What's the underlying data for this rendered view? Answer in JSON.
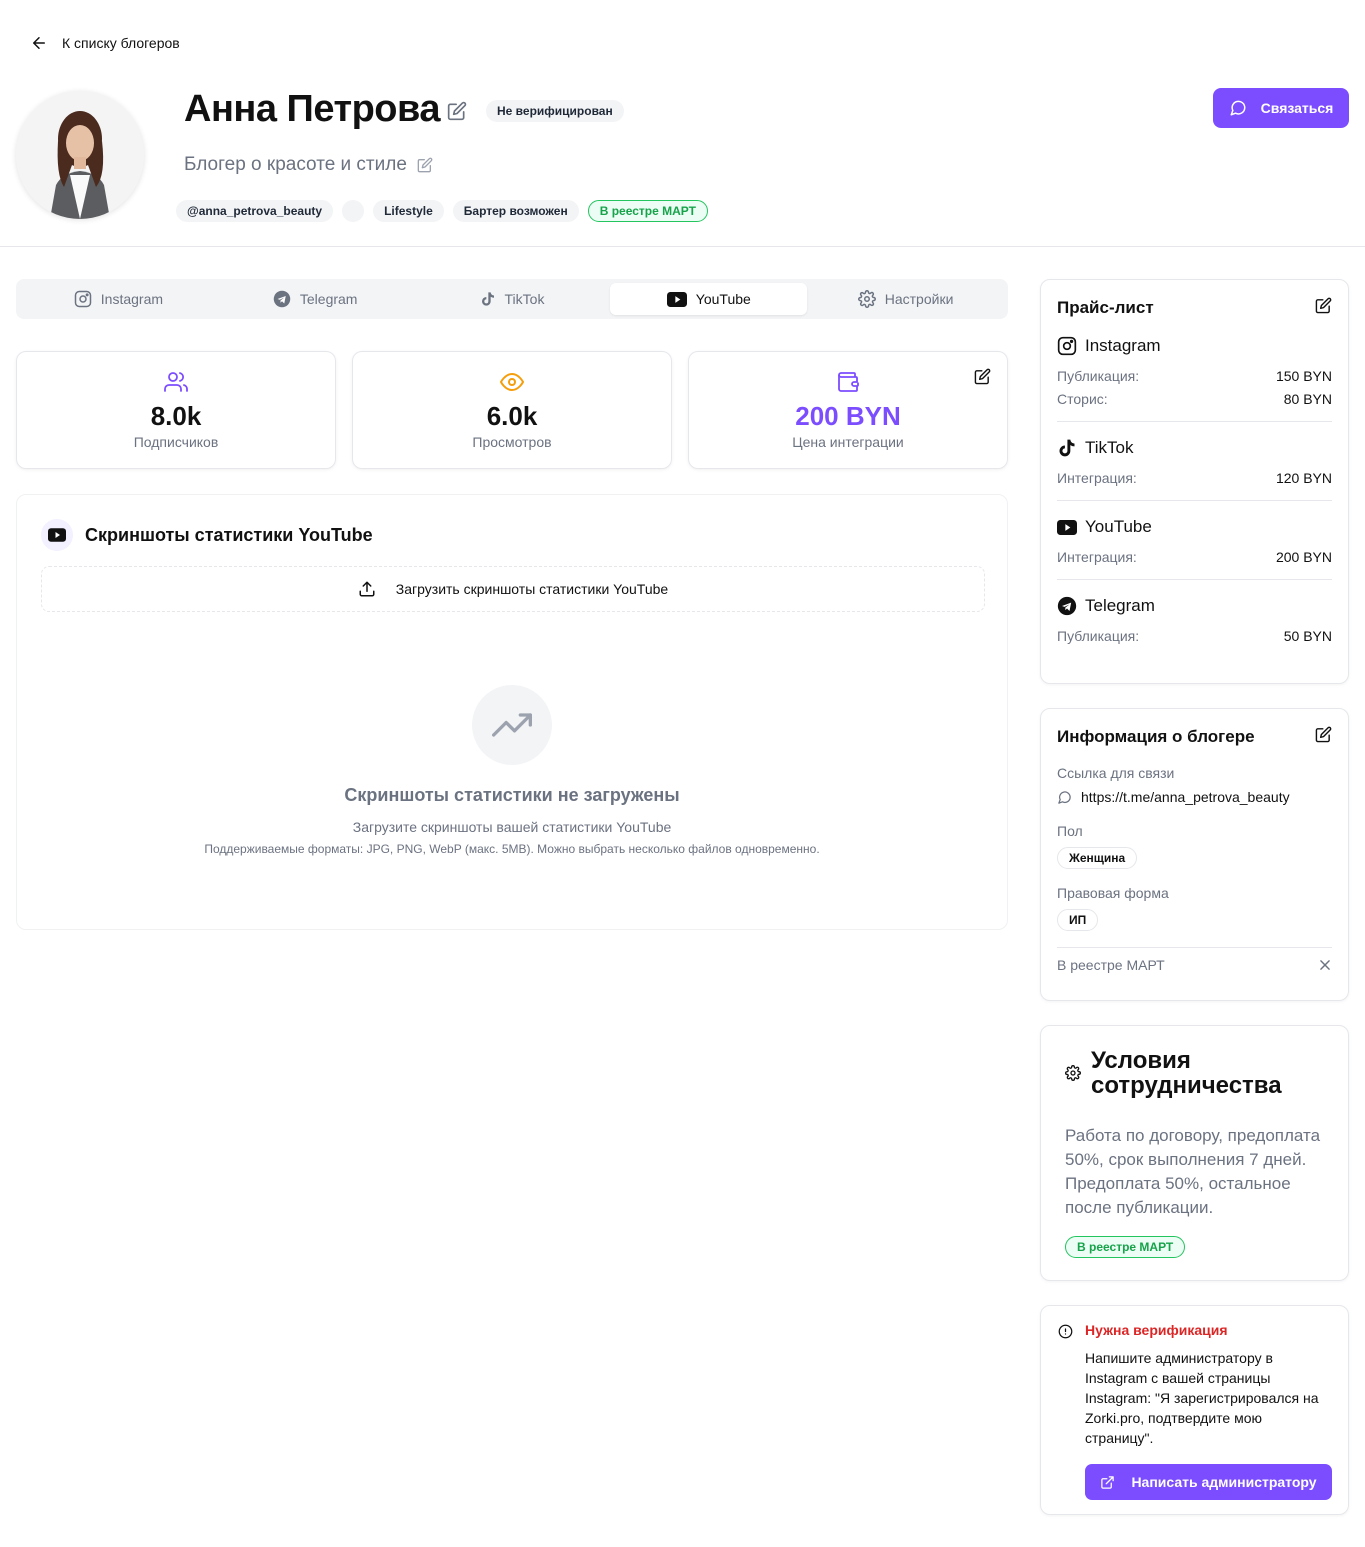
{
  "back": {
    "label": "К списку блогеров"
  },
  "profile": {
    "name": "Анна Петрова",
    "verify_badge": "Не верифицирован",
    "subtitle": "Блогер о красоте и стиле",
    "tags": [
      "@anna_petrova_beauty",
      "",
      "Lifestyle",
      "Бартер возможен"
    ],
    "registry_tag": "В реестре МАРТ"
  },
  "contact_button": "Связаться",
  "tabs": [
    {
      "label": "Instagram",
      "icon": "instagram-icon"
    },
    {
      "label": "Telegram",
      "icon": "telegram-icon"
    },
    {
      "label": "TikTok",
      "icon": "tiktok-icon"
    },
    {
      "label": "YouTube",
      "icon": "youtube-icon",
      "active": true
    },
    {
      "label": "Настройки",
      "icon": "gear-icon"
    }
  ],
  "stats": [
    {
      "value": "8.0k",
      "label": "Подписчиков",
      "icon": "users-icon"
    },
    {
      "value": "6.0k",
      "label": "Просмотров",
      "icon": "eye-icon"
    },
    {
      "value": "200 BYN",
      "label": "Цена интеграции",
      "icon": "wallet-icon"
    }
  ],
  "screenshots": {
    "title": "Скриншоты статистики YouTube",
    "upload_label": "Загрузить скриншоты статистики YouTube",
    "empty_title": "Скриншоты статистики не загружены",
    "empty_text": "Загрузите скриншоты вашей статистики YouTube",
    "formats_text": "Поддерживаемые форматы: JPG, PNG, WebP (макс. 5MB). Можно выбрать несколько файлов одновременно."
  },
  "pricelist": {
    "title": "Прайс-лист",
    "sections": [
      {
        "platform": "Instagram",
        "items": [
          {
            "label": "Публикация:",
            "price": "150 BYN"
          },
          {
            "label": "Сторис:",
            "price": "80 BYN"
          }
        ]
      },
      {
        "platform": "TikTok",
        "items": [
          {
            "label": "Интеграция:",
            "price": "120 BYN"
          }
        ]
      },
      {
        "platform": "YouTube",
        "items": [
          {
            "label": "Интеграция:",
            "price": "200 BYN"
          }
        ]
      },
      {
        "platform": "Telegram",
        "items": [
          {
            "label": "Публикация:",
            "price": "50 BYN"
          }
        ]
      }
    ]
  },
  "info": {
    "title": "Информация о блогере",
    "contact_label": "Ссылка для связи",
    "contact_value": "https://t.me/anna_petrova_beauty",
    "gender_label": "Пол",
    "gender_value": "Женщина",
    "legal_label": "Правовая форма",
    "legal_value": "ИП",
    "registry_label": "В реестре МАРТ"
  },
  "terms": {
    "title": "Условия сотрудничества",
    "text": "Работа по договору, предоплата 50%, срок выполнения 7 дней. Предоплата 50%, остальное после публикации.",
    "badge": "В реестре МАРТ"
  },
  "verification": {
    "title": "Нужна верификация",
    "text": "Напишите администратору в Instagram с вашей страницы Instagram: \"Я зарегистрировался на Zorki.pro, подтвердите мою страницу\".",
    "button": "Написать администратору"
  },
  "colors": {
    "accent": "#7c4dff",
    "success": "#16a34a",
    "danger": "#dc2626",
    "warning": "#f59e0b"
  }
}
